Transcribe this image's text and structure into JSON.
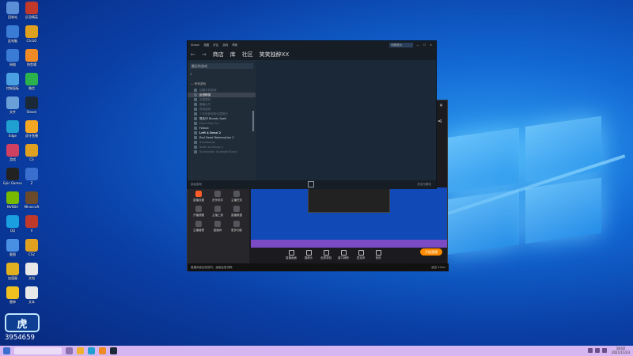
{
  "desktop_icons": [
    {
      "label": "回收站",
      "color": "#5a8fd8"
    },
    {
      "label": "反恐精英",
      "color": "#c0392b"
    },
    {
      "label": "此电脑",
      "color": "#3a7bd5"
    },
    {
      "label": "CS:GO",
      "color": "#e0a020"
    },
    {
      "label": "网络",
      "color": "#3a7bd5"
    },
    {
      "label": "快剪辑",
      "color": "#f08a24"
    },
    {
      "label": "控制面板",
      "color": "#4aa0e0"
    },
    {
      "label": "微信",
      "color": "#2bb24c"
    },
    {
      "label": "文件",
      "color": "#6aa0d8"
    },
    {
      "label": "Steam",
      "color": "#1b2838"
    },
    {
      "label": "Edge",
      "color": "#1fa0d0"
    },
    {
      "label": "虎牙直播",
      "color": "#f5a623"
    },
    {
      "label": "游戏",
      "color": "#d04060"
    },
    {
      "label": "CS",
      "color": "#e0a020"
    },
    {
      "label": "Epic Games",
      "color": "#222222"
    },
    {
      "label": "Z",
      "color": "#3a6fd0"
    },
    {
      "label": "NVIDIA",
      "color": "#76b900"
    },
    {
      "label": "Minecraft",
      "color": "#6a4a2a"
    },
    {
      "label": "QQ",
      "color": "#1aa0e0"
    },
    {
      "label": "V",
      "color": "#c0392b"
    },
    {
      "label": "截图",
      "color": "#4a90e2"
    },
    {
      "label": "CS2",
      "color": "#e0a020"
    },
    {
      "label": "加速器",
      "color": "#e0b020"
    },
    {
      "label": "文档",
      "color": "#e8e8e8"
    },
    {
      "label": "雷神",
      "color": "#f0c020"
    },
    {
      "label": "文本",
      "color": "#e8e8e8"
    }
  ],
  "live_logo": {
    "text": "虎",
    "number": "3954659"
  },
  "steam": {
    "menu": [
      "Steam",
      "视图",
      "好友",
      "游戏",
      "帮助"
    ],
    "account": "阿斯顿大",
    "window_controls": [
      "—",
      "☐",
      "✕"
    ],
    "nav": {
      "back": "←",
      "forward": "→",
      "store": "商店",
      "library": "库",
      "community": "社区",
      "user": "笑笑独醉XX"
    },
    "library": {
      "filter": "最近的游戏",
      "category": "— 所有游戏",
      "games": [
        {
          "name": "加载中的游戏",
          "state": "dim"
        },
        {
          "name": "反恐精英",
          "state": "active"
        },
        {
          "name": "无畏契约",
          "state": "dim"
        },
        {
          "name": "魔兽大厅",
          "state": "dim"
        },
        {
          "name": "吃鸡游戏",
          "state": "dim"
        },
        {
          "name": "7 天杀死你的无畏契约",
          "state": "dim"
        },
        {
          "name": "嗜血印 Bloody Spell",
          "state": "normal"
        },
        {
          "name": "Devil May Cry",
          "state": "dim"
        },
        {
          "name": "Fallout",
          "state": "normal"
        },
        {
          "name": "Left 4 Dead 2",
          "state": "bold"
        },
        {
          "name": "Red Dead Redemption 2",
          "state": "normal"
        },
        {
          "name": "Snowbreak",
          "state": "dim"
        },
        {
          "name": "State of Decay 2",
          "state": "dim"
        },
        {
          "name": "Survivalist: Invisible Strain",
          "state": "dim"
        }
      ]
    },
    "bottom": {
      "add_game": "添加游戏",
      "friends": "好友与聊天"
    }
  },
  "stream": {
    "tools": [
      {
        "label": "直播设置",
        "state": "red"
      },
      {
        "label": "虎牙助手",
        "state": "normal"
      },
      {
        "label": "主播任务",
        "state": "normal"
      },
      {
        "label": "开播提醒",
        "state": "normal"
      },
      {
        "label": "主播工具",
        "state": "normal"
      },
      {
        "label": "直播数据",
        "state": "normal"
      },
      {
        "label": "主播管理",
        "state": "normal"
      },
      {
        "label": "直播间",
        "state": "normal"
      },
      {
        "label": "更多功能",
        "state": "normal"
      }
    ],
    "controls": [
      "直播画面",
      "摄像头",
      "全屏录制",
      "窗口捕获",
      "麦克风",
      "音效"
    ],
    "start_label": "开始直播",
    "footer": "直播间延迟较低时，画面会更流畅",
    "ping": "延迟 45ms",
    "share_icon": "share-icon"
  },
  "taskbar": {
    "time": "18:02",
    "date": "2021/11/23"
  }
}
